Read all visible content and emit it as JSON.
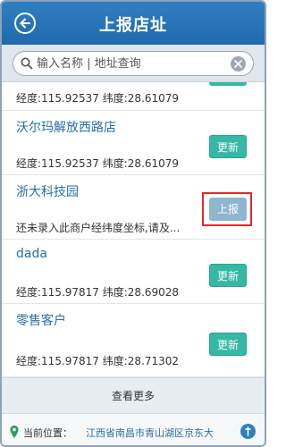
{
  "header": {
    "title": "上报店址",
    "back_icon": "arrow-left-icon"
  },
  "search": {
    "placeholder": "输入名称 | 地址查询"
  },
  "list": {
    "partial_first_row": {
      "coords": "经度:115.92537 纬度:28.61079"
    },
    "items": [
      {
        "name": "沃尔玛解放西路店",
        "coords": "经度:115.92537 纬度:28.61079",
        "action": "更新"
      },
      {
        "name": "浙大科技园",
        "coords": "还未录入此商户经纬度坐标,请及...",
        "action": "上报"
      },
      {
        "name": "dada",
        "coords": "经度:115.97817 纬度:28.69028",
        "action": "更新"
      },
      {
        "name": "零售客户",
        "coords": "经度:115.97817 纬度:28.71302",
        "action": "更新"
      }
    ]
  },
  "load_more": "查看更多",
  "footer": {
    "label": "当前位置：",
    "location": "江西省南昌市青山湖区京东大"
  },
  "colors": {
    "header": "#1f6aab",
    "update_button": "#35b8a5",
    "report_button": "#8eb6cf",
    "highlight": "#e02a2a"
  }
}
